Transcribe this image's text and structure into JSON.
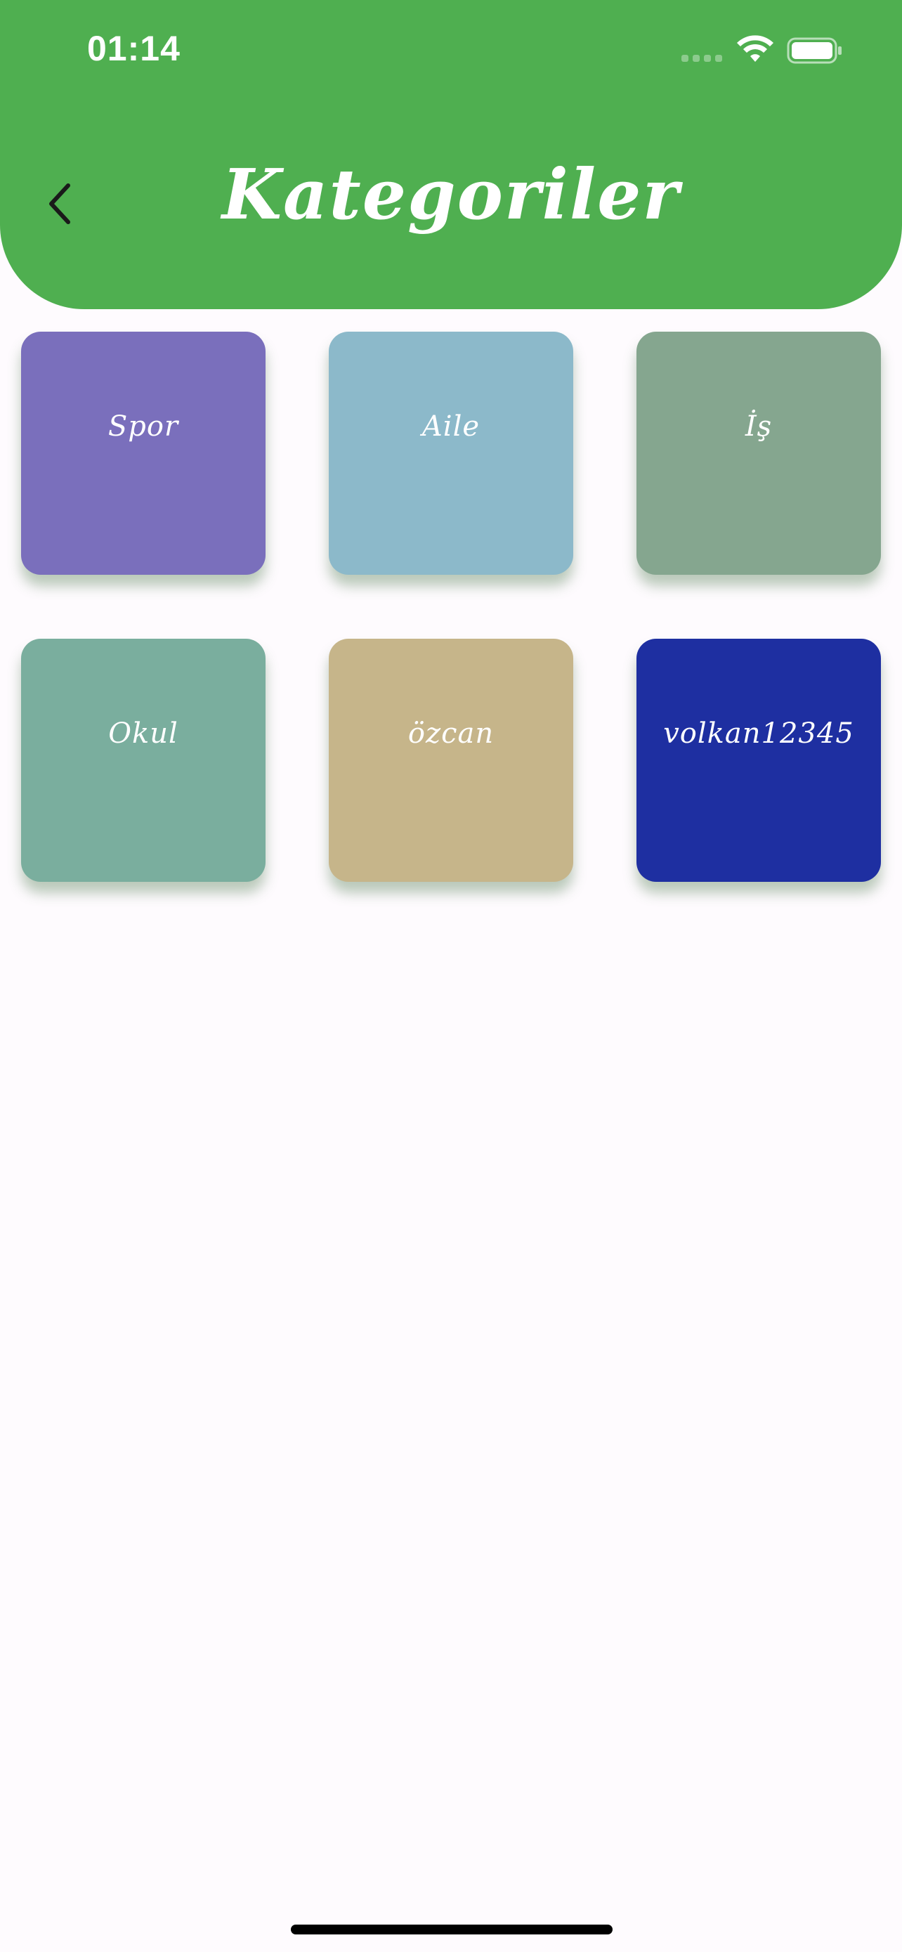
{
  "status_bar": {
    "time": "01:14"
  },
  "header": {
    "title": "Kategoriler",
    "background_color": "#4FAF50",
    "back_icon": "chevron-left-icon"
  },
  "categories": [
    {
      "label": "Spor",
      "color": "#7A6FBC"
    },
    {
      "label": "Aile",
      "color": "#8CB9CA"
    },
    {
      "label": "İş",
      "color": "#85A68F"
    },
    {
      "label": "Okul",
      "color": "#7AAE9E"
    },
    {
      "label": "özcan",
      "color": "#C6B58A"
    },
    {
      "label": "volkan12345",
      "color": "#1E2FA1"
    }
  ]
}
